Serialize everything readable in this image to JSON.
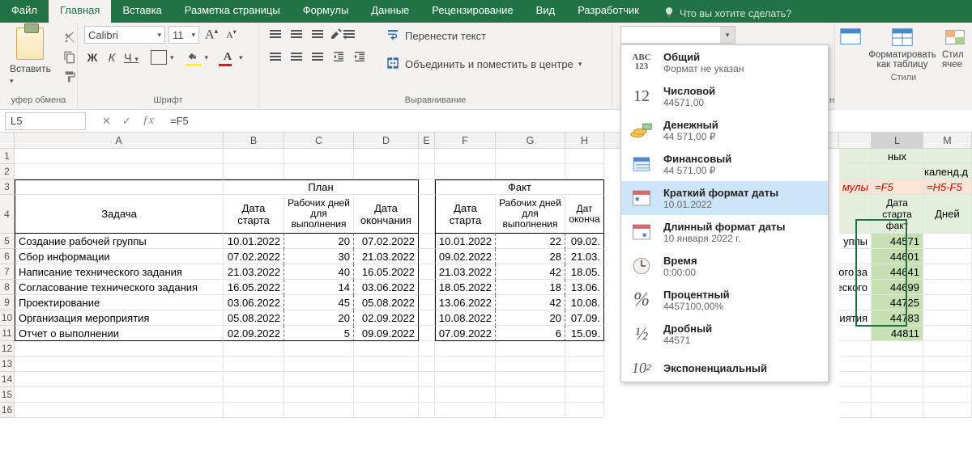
{
  "tabs": {
    "file": "Файл",
    "home": "Главная",
    "insert": "Вставка",
    "layout": "Разметка страницы",
    "formulas": "Формулы",
    "data": "Данные",
    "review": "Рецензирование",
    "view": "Вид",
    "developer": "Разработчик"
  },
  "tellme": "Что вы хотите сделать?",
  "groups": {
    "clipboard": "уфер обмена",
    "font": "Шрифт",
    "align": "Выравнивание",
    "styles": "Стили"
  },
  "paste": "Вставить",
  "font": {
    "name": "Calibri",
    "size": "11"
  },
  "bold": "Ж",
  "italic": "К",
  "underline": "Ч",
  "wrap": "Перенести текст",
  "merge": "Объединить и поместить в центре",
  "formatTable": "Форматировать как таблицу",
  "cellStyles": "Стил ячее",
  "numfmt_end": "ние",
  "namebox": "L5",
  "formula": "=F5",
  "fmt": {
    "general": {
      "t": "Общий",
      "s": "Формат не указан"
    },
    "number": {
      "t": "Числовой",
      "s": "44571,00"
    },
    "currency": {
      "t": "Денежный",
      "s": "44 571,00 ₽"
    },
    "accounting": {
      "t": "Финансовый",
      "s": "44 571,00 ₽"
    },
    "shortdate": {
      "t": "Краткий формат даты",
      "s": "10.01.2022"
    },
    "longdate": {
      "t": "Длинный формат даты",
      "s": "10 января 2022 г."
    },
    "time": {
      "t": "Время",
      "s": "0:00:00"
    },
    "percent": {
      "t": "Процентный",
      "s": "4457100,00%"
    },
    "fraction": {
      "t": "Дробный",
      "s": "44571"
    },
    "sci": {
      "t": "Экспоненциальный",
      "s": ""
    }
  },
  "colw": {
    "A": 258,
    "B": 75,
    "C": 86,
    "D": 80,
    "E": 20,
    "F": 75,
    "G": 86,
    "H": 40,
    "I": 60,
    "J": 60,
    "K": 64,
    "L": 64,
    "M": 64
  },
  "sheet": {
    "plan": "План",
    "fact": "Факт",
    "h": {
      "task": "Задача",
      "start": "Дата старта",
      "days": "Рабочих дней для выполнения",
      "end": "Дата окончания",
      "end2": "Дат оконча"
    },
    "rows": [
      {
        "task": "Создание рабочей группы",
        "ps": "10.01.2022",
        "pd": "20",
        "pe": "07.02.2022",
        "fs": "10.01.2022",
        "fd": "22",
        "fe": "09.02."
      },
      {
        "task": "Сбор информации",
        "ps": "07.02.2022",
        "pd": "30",
        "pe": "21.03.2022",
        "fs": "09.02.2022",
        "fd": "28",
        "fe": "21.03."
      },
      {
        "task": "Написание технического задания",
        "ps": "21.03.2022",
        "pd": "40",
        "pe": "16.05.2022",
        "fs": "21.03.2022",
        "fd": "42",
        "fe": "18.05."
      },
      {
        "task": "Согласование технического задания",
        "ps": "16.05.2022",
        "pd": "14",
        "pe": "03.06.2022",
        "fs": "18.05.2022",
        "fd": "18",
        "fe": "13.06."
      },
      {
        "task": "Проектирование",
        "ps": "03.06.2022",
        "pd": "45",
        "pe": "05.08.2022",
        "fs": "13.06.2022",
        "fd": "42",
        "fe": "10.08."
      },
      {
        "task": "Организация мероприятия",
        "ps": "05.08.2022",
        "pd": "20",
        "pe": "02.09.2022",
        "fs": "10.08.2022",
        "fd": "20",
        "fe": "07.09."
      },
      {
        "task": "Отчет о выполнении",
        "ps": "02.09.2022",
        "pd": "5",
        "pe": "09.09.2022",
        "fs": "07.09.2022",
        "fd": "6",
        "fe": "15.09."
      }
    ]
  },
  "right": {
    "r1": "ных",
    "r2": "календ.д",
    "r3a": "мулы",
    "r3b": "=F5",
    "r3c": "=H5-F5",
    "h1": "Дата старта факт",
    "h2": "Дней",
    "krows": [
      "уппы",
      "",
      "кого за",
      "ческого",
      "",
      "риятия",
      ""
    ],
    "vals": [
      "44571",
      "44601",
      "44641",
      "44699",
      "44725",
      "44783",
      "44811"
    ]
  }
}
